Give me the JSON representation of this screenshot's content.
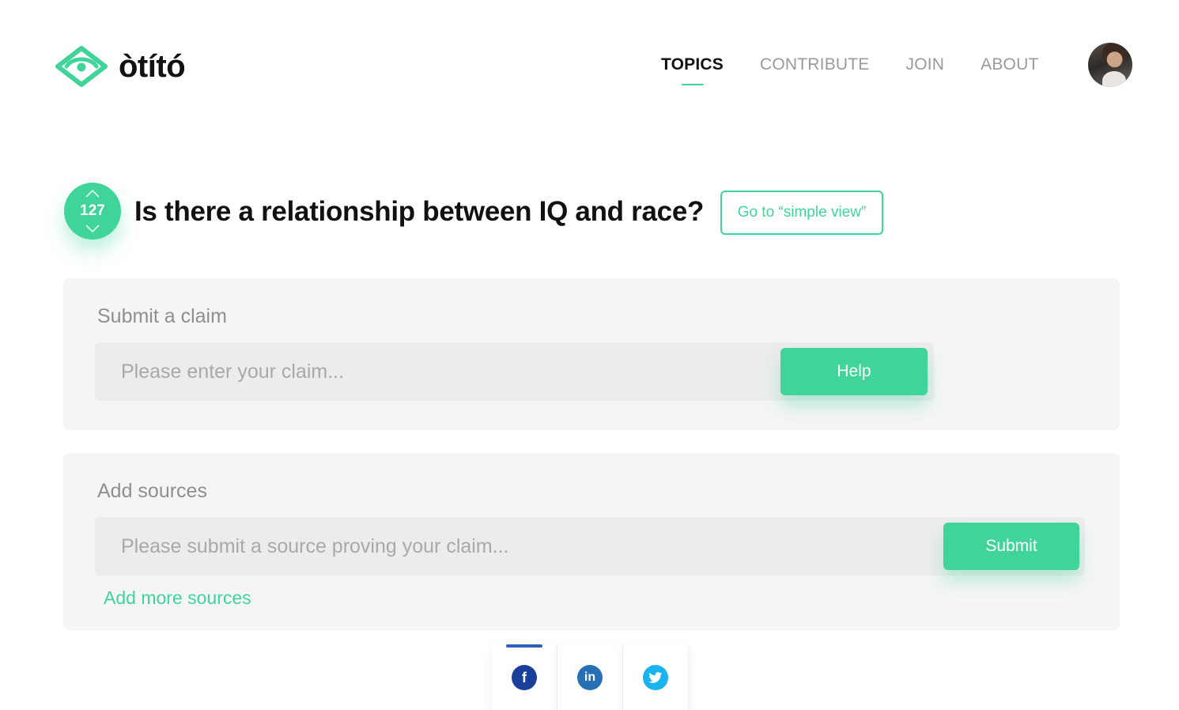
{
  "brand": {
    "name": "òtító",
    "accent": "#41d49a"
  },
  "nav": {
    "items": [
      {
        "label": "TOPICS",
        "active": true
      },
      {
        "label": "CONTRIBUTE",
        "active": false
      },
      {
        "label": "JOIN",
        "active": false
      },
      {
        "label": "ABOUT",
        "active": false
      }
    ]
  },
  "question": {
    "votes": "127",
    "title": "Is there a relationship between IQ and race?",
    "simple_view_label": "Go to “simple view”"
  },
  "claim": {
    "title": "Submit a claim",
    "placeholder": "Please enter your claim...",
    "help_label": "Help"
  },
  "sources": {
    "title": "Add sources",
    "placeholder": "Please submit a source proving your claim...",
    "submit_label": "Submit",
    "add_more_label": "Add more sources"
  },
  "share": {
    "items": [
      {
        "icon": "facebook-icon",
        "glyph": "f",
        "active": true
      },
      {
        "icon": "linkedin-icon",
        "glyph": "in",
        "active": false
      },
      {
        "icon": "twitter-icon",
        "glyph": "",
        "active": false
      }
    ]
  }
}
